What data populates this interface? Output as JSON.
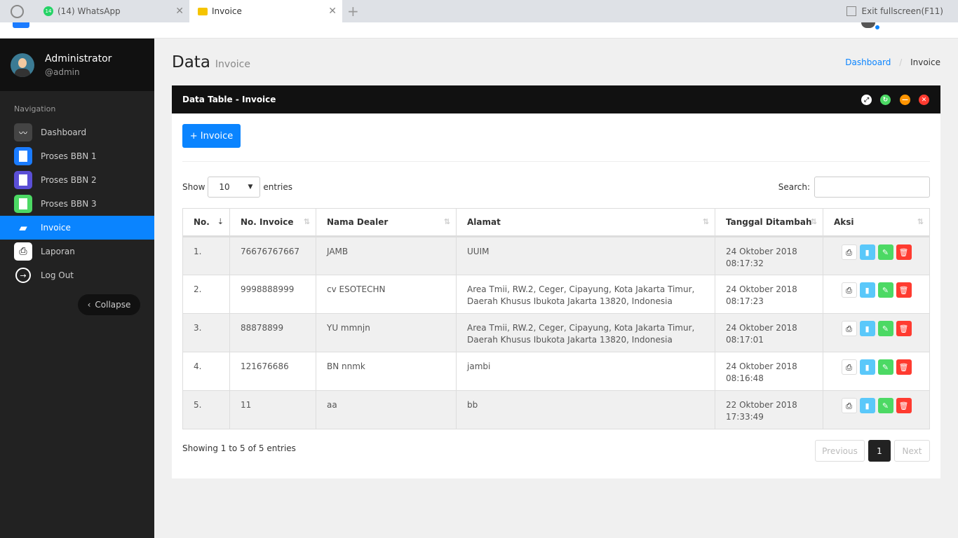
{
  "browser": {
    "tabs": [
      {
        "label": "(14) WhatsApp",
        "badge": "14"
      },
      {
        "label": "Invoice"
      }
    ],
    "exit_fullscreen": "Exit fullscreen(F11)"
  },
  "user": {
    "name": "Administrator",
    "handle": "@admin"
  },
  "sidebar": {
    "heading": "Navigation",
    "items": [
      {
        "label": "Dashboard",
        "icon": "pulse-icon",
        "color": "#444444"
      },
      {
        "label": "Proses BBN 1",
        "icon": "file-icon",
        "color": "#1a7bff"
      },
      {
        "label": "Proses BBN 2",
        "icon": "file-icon",
        "color": "#5b4fd6"
      },
      {
        "label": "Proses BBN 3",
        "icon": "file-icon",
        "color": "#4cd964"
      },
      {
        "label": "Invoice",
        "icon": "book-icon",
        "active": true
      },
      {
        "label": "Laporan",
        "icon": "printer-icon",
        "color": "#ffffff"
      },
      {
        "label": "Log Out",
        "icon": "logout-icon"
      }
    ],
    "collapse": "Collapse"
  },
  "page": {
    "title": "Data",
    "subtitle": "Invoice",
    "breadcrumb": [
      "Dashboard",
      "Invoice"
    ]
  },
  "panel": {
    "title": "Data Table - Invoice",
    "add_button": "+ Invoice",
    "show": "Show",
    "entries_value": "10",
    "entries": "entries",
    "search_label": "Search:",
    "search_value": "",
    "columns": [
      "No.",
      "No. Invoice",
      "Nama Dealer",
      "Alamat",
      "Tanggal Ditambah",
      "Aksi"
    ],
    "rows": [
      {
        "no": "1.",
        "invoice": "76676767667",
        "dealer": "JAMB",
        "alamat": "UUIM",
        "date": "24 Oktober 2018",
        "time": "08:17:32"
      },
      {
        "no": "2.",
        "invoice": "9998888999",
        "dealer": "cv ESOTECHN",
        "alamat": "Area Tmii, RW.2, Ceger, Cipayung, Kota Jakarta Timur, Daerah Khusus Ibukota Jakarta 13820, Indonesia",
        "date": "24 Oktober 2018",
        "time": "08:17:23"
      },
      {
        "no": "3.",
        "invoice": "88878899",
        "dealer": "YU mmnjn",
        "alamat": "Area Tmii, RW.2, Ceger, Cipayung, Kota Jakarta Timur, Daerah Khusus Ibukota Jakarta 13820, Indonesia",
        "date": "24 Oktober 2018",
        "time": "08:17:01"
      },
      {
        "no": "4.",
        "invoice": "121676686",
        "dealer": "BN nnmk",
        "alamat": "jambi",
        "date": "24 Oktober 2018",
        "time": "08:16:48"
      },
      {
        "no": "5.",
        "invoice": "11",
        "dealer": "aa",
        "alamat": "bb",
        "date": "22 Oktober 2018",
        "time": "17:33:49"
      }
    ],
    "info": "Showing 1 to 5 of 5 entries",
    "previous": "Previous",
    "page": "1",
    "next": "Next"
  },
  "colors": {
    "accent": "#0a84ff",
    "sidebar": "#222222",
    "print": "#ffffff",
    "view": "#5ac8fa",
    "edit": "#4cd964",
    "delete": "#ff3b30"
  }
}
